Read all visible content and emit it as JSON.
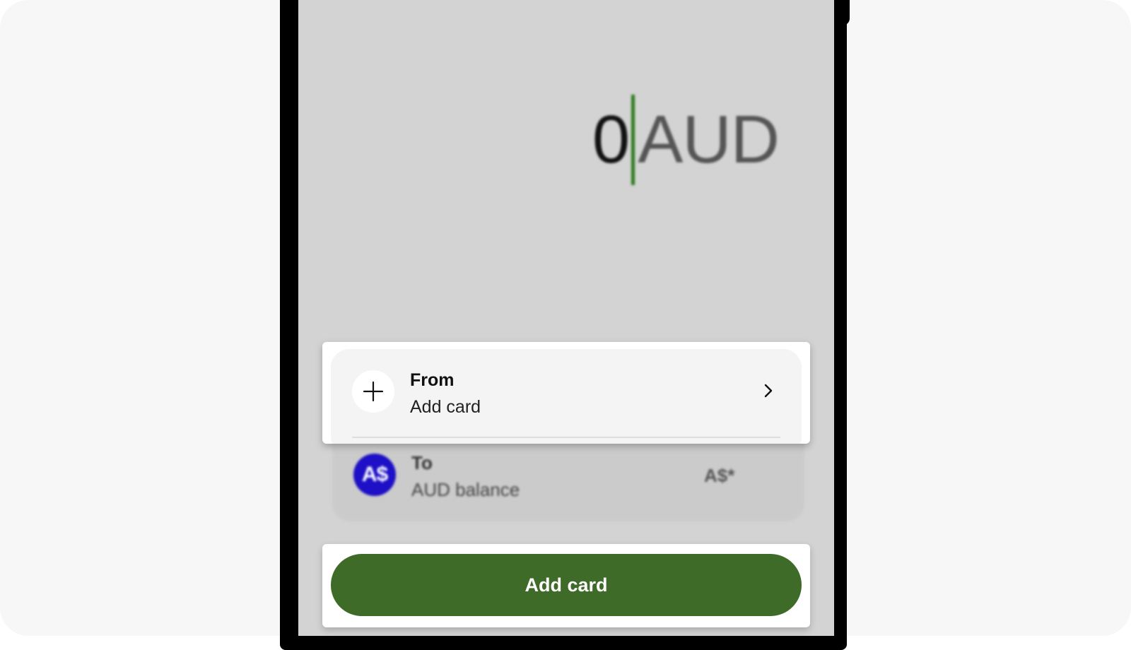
{
  "amount": {
    "value": "0",
    "currency": "AUD"
  },
  "from": {
    "title": "From",
    "subtitle": "Add card",
    "icon": "plus-icon",
    "chevron": "chevron-right-icon"
  },
  "to": {
    "title": "To",
    "subtitle": "AUD balance",
    "avatar_text": "A$",
    "right_text": "A$*",
    "avatar_color": "#1d10c6"
  },
  "cta": {
    "label": "Add card",
    "color": "#3e6b27"
  },
  "colors": {
    "caret": "#2d7a1f",
    "screen_overlay": "#d3d3d3"
  }
}
